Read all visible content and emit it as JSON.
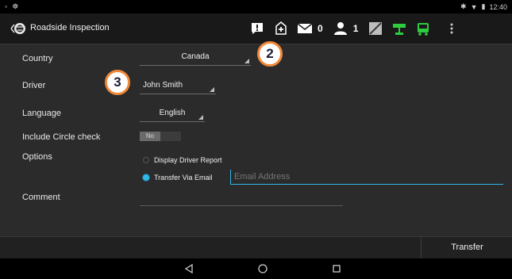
{
  "status_bar": {
    "time": "12:40"
  },
  "app_bar": {
    "title": "Roadside Inspection",
    "toolbar": {
      "mail_count": "0",
      "user_count": "1"
    }
  },
  "form": {
    "country": {
      "label": "Country",
      "value": "Canada"
    },
    "driver": {
      "label": "Driver",
      "value": "John Smith"
    },
    "language": {
      "label": "Language",
      "value": "English"
    },
    "circle_check": {
      "label": "Include Circle check",
      "toggle_text": "No"
    },
    "options": {
      "label": "Options",
      "display_report": "Display Driver Report",
      "transfer_email": "Transfer Via Email",
      "email_placeholder": "Email Address"
    },
    "comment": {
      "label": "Comment"
    }
  },
  "actions": {
    "transfer": "Transfer"
  },
  "callouts": {
    "a": "2",
    "b": "3"
  },
  "colors": {
    "accent": "#33b5e5",
    "callout_border": "#f0883a",
    "icon_green": "#2ecc40"
  }
}
